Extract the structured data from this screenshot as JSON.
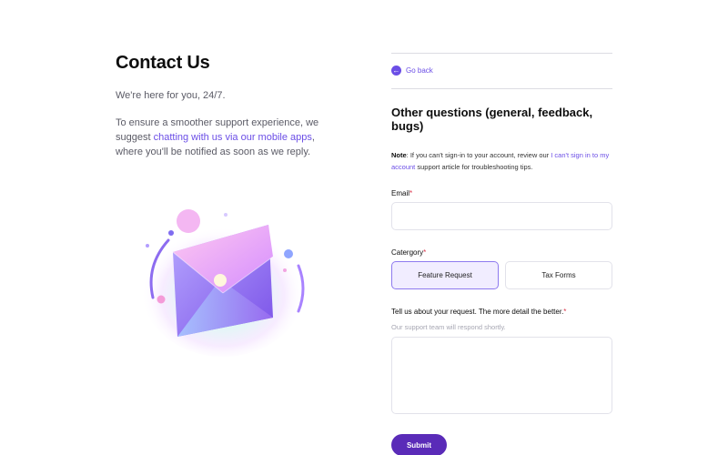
{
  "left": {
    "title": "Contact Us",
    "tagline": "We're here for you, 24/7.",
    "desc_before": "To ensure a smoother support experience, we suggest ",
    "desc_link": "chatting with us via our mobile apps",
    "desc_after": ", where you'll be notified as soon as we reply.",
    "illustration_icon": "envelope-illustration"
  },
  "right": {
    "back_label": "Go back",
    "back_icon": "arrow-left-icon",
    "form_title": "Other questions (general, feedback, bugs)",
    "note_label": "Note",
    "note_text": ": If you can't sign-in to your account, review our ",
    "note_link": "I can't sign in to my account",
    "note_after": " support article for troubleshooting tips.",
    "email_label": "Email",
    "email_value": "",
    "category_label": "Catergory",
    "categories": [
      {
        "label": "Feature Request",
        "selected": true
      },
      {
        "label": "Tax Forms",
        "selected": false
      }
    ],
    "request_label": "Tell us about your request. The more detail the better.",
    "request_helper": "Our support team will respond shortly.",
    "request_value": "",
    "required_mark": "*",
    "submit_label": "Submit"
  },
  "colors": {
    "accent": "#6b4ee6",
    "submit": "#5a2bb8",
    "required": "#d9364b",
    "selected_bg": "#f1edff"
  }
}
